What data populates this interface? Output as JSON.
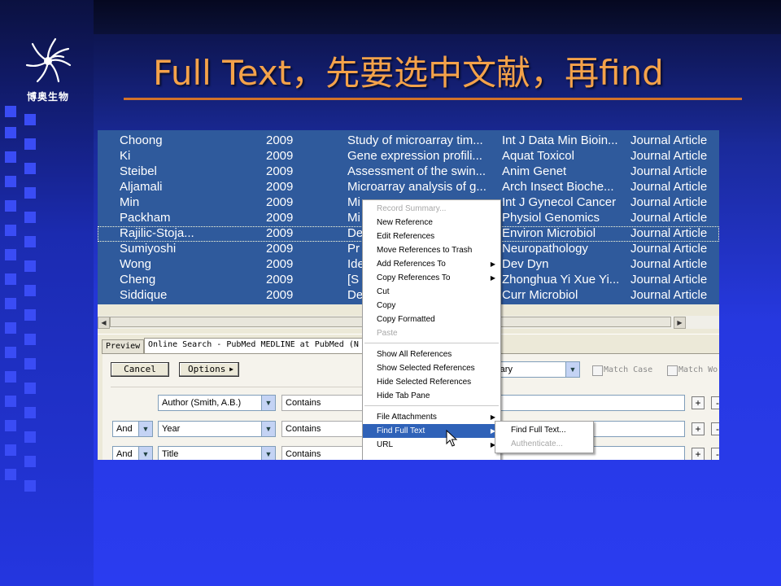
{
  "slide": {
    "title": "Full Text，先要选中文献，再find",
    "logo_text": "博奥生物",
    "colors": {
      "title": "#f4a24a",
      "rule": "#d2722a",
      "selection": "#2f5a9c",
      "menu_highlight": "#2f62b8"
    }
  },
  "references": [
    {
      "author": "Choong",
      "year": "2009",
      "title": "Study of microarray tim...",
      "journal": "Int J Data Min Bioin...",
      "type": "Journal Article"
    },
    {
      "author": "Ki",
      "year": "2009",
      "title": "Gene expression profili...",
      "journal": "Aquat Toxicol",
      "type": "Journal Article"
    },
    {
      "author": "Steibel",
      "year": "2009",
      "title": "Assessment of the swin...",
      "journal": "Anim Genet",
      "type": "Journal Article"
    },
    {
      "author": "Aljamali",
      "year": "2009",
      "title": "Microarray analysis of g...",
      "journal": "Arch Insect Bioche...",
      "type": "Journal Article"
    },
    {
      "author": "Min",
      "year": "2009",
      "title": "Mi",
      "journal": "Int J Gynecol Cancer",
      "type": "Journal Article"
    },
    {
      "author": "Packham",
      "year": "2009",
      "title": "Mi",
      "journal": "Physiol Genomics",
      "type": "Journal Article"
    },
    {
      "author": "Rajilic-Stoja...",
      "year": "2009",
      "title": "De",
      "journal": "Environ Microbiol",
      "type": "Journal Article"
    },
    {
      "author": "Sumiyoshi",
      "year": "2009",
      "title": "Pr",
      "journal": "Neuropathology",
      "type": "Journal Article"
    },
    {
      "author": "Wong",
      "year": "2009",
      "title": "Ide",
      "journal": "Dev Dyn",
      "type": "Journal Article"
    },
    {
      "author": "Cheng",
      "year": "2009",
      "title": "[S",
      "journal": "Zhonghua Yi Xue Yi...",
      "type": "Journal Article"
    },
    {
      "author": "Siddique",
      "year": "2009",
      "title": "De",
      "journal": "Curr Microbiol",
      "type": "Journal Article"
    }
  ],
  "tabs": {
    "preview": "Preview",
    "online_search": "Online Search - PubMed MEDLINE at PubMed (N"
  },
  "panel": {
    "cancel_label": "Cancel",
    "options_label": "Options",
    "library_select": "rary",
    "match_case": "Match Case",
    "match_words": "Match Wo",
    "rows": [
      {
        "bool": "",
        "field": "Author (Smith, A.B.)",
        "op": "Contains"
      },
      {
        "bool": "And",
        "field": "Year",
        "op": "Contains"
      },
      {
        "bool": "And",
        "field": "Title",
        "op": "Contains"
      }
    ],
    "plus": "+",
    "minus": "-"
  },
  "context_menu": {
    "record_summary": "Record Summary...",
    "new_reference": "New Reference",
    "edit_references": "Edit References",
    "move_to_trash": "Move References to Trash",
    "add_references_to": "Add References To",
    "copy_references_to": "Copy References To",
    "cut": "Cut",
    "copy": "Copy",
    "copy_formatted": "Copy Formatted",
    "paste": "Paste",
    "show_all": "Show All References",
    "show_selected": "Show Selected References",
    "hide_selected": "Hide Selected References",
    "hide_tab_pane": "Hide Tab Pane",
    "file_attachments": "File Attachments",
    "find_full_text": "Find Full Text",
    "url": "URL"
  },
  "submenu": {
    "find_full_text": "Find Full Text...",
    "authenticate": "Authenticate..."
  }
}
